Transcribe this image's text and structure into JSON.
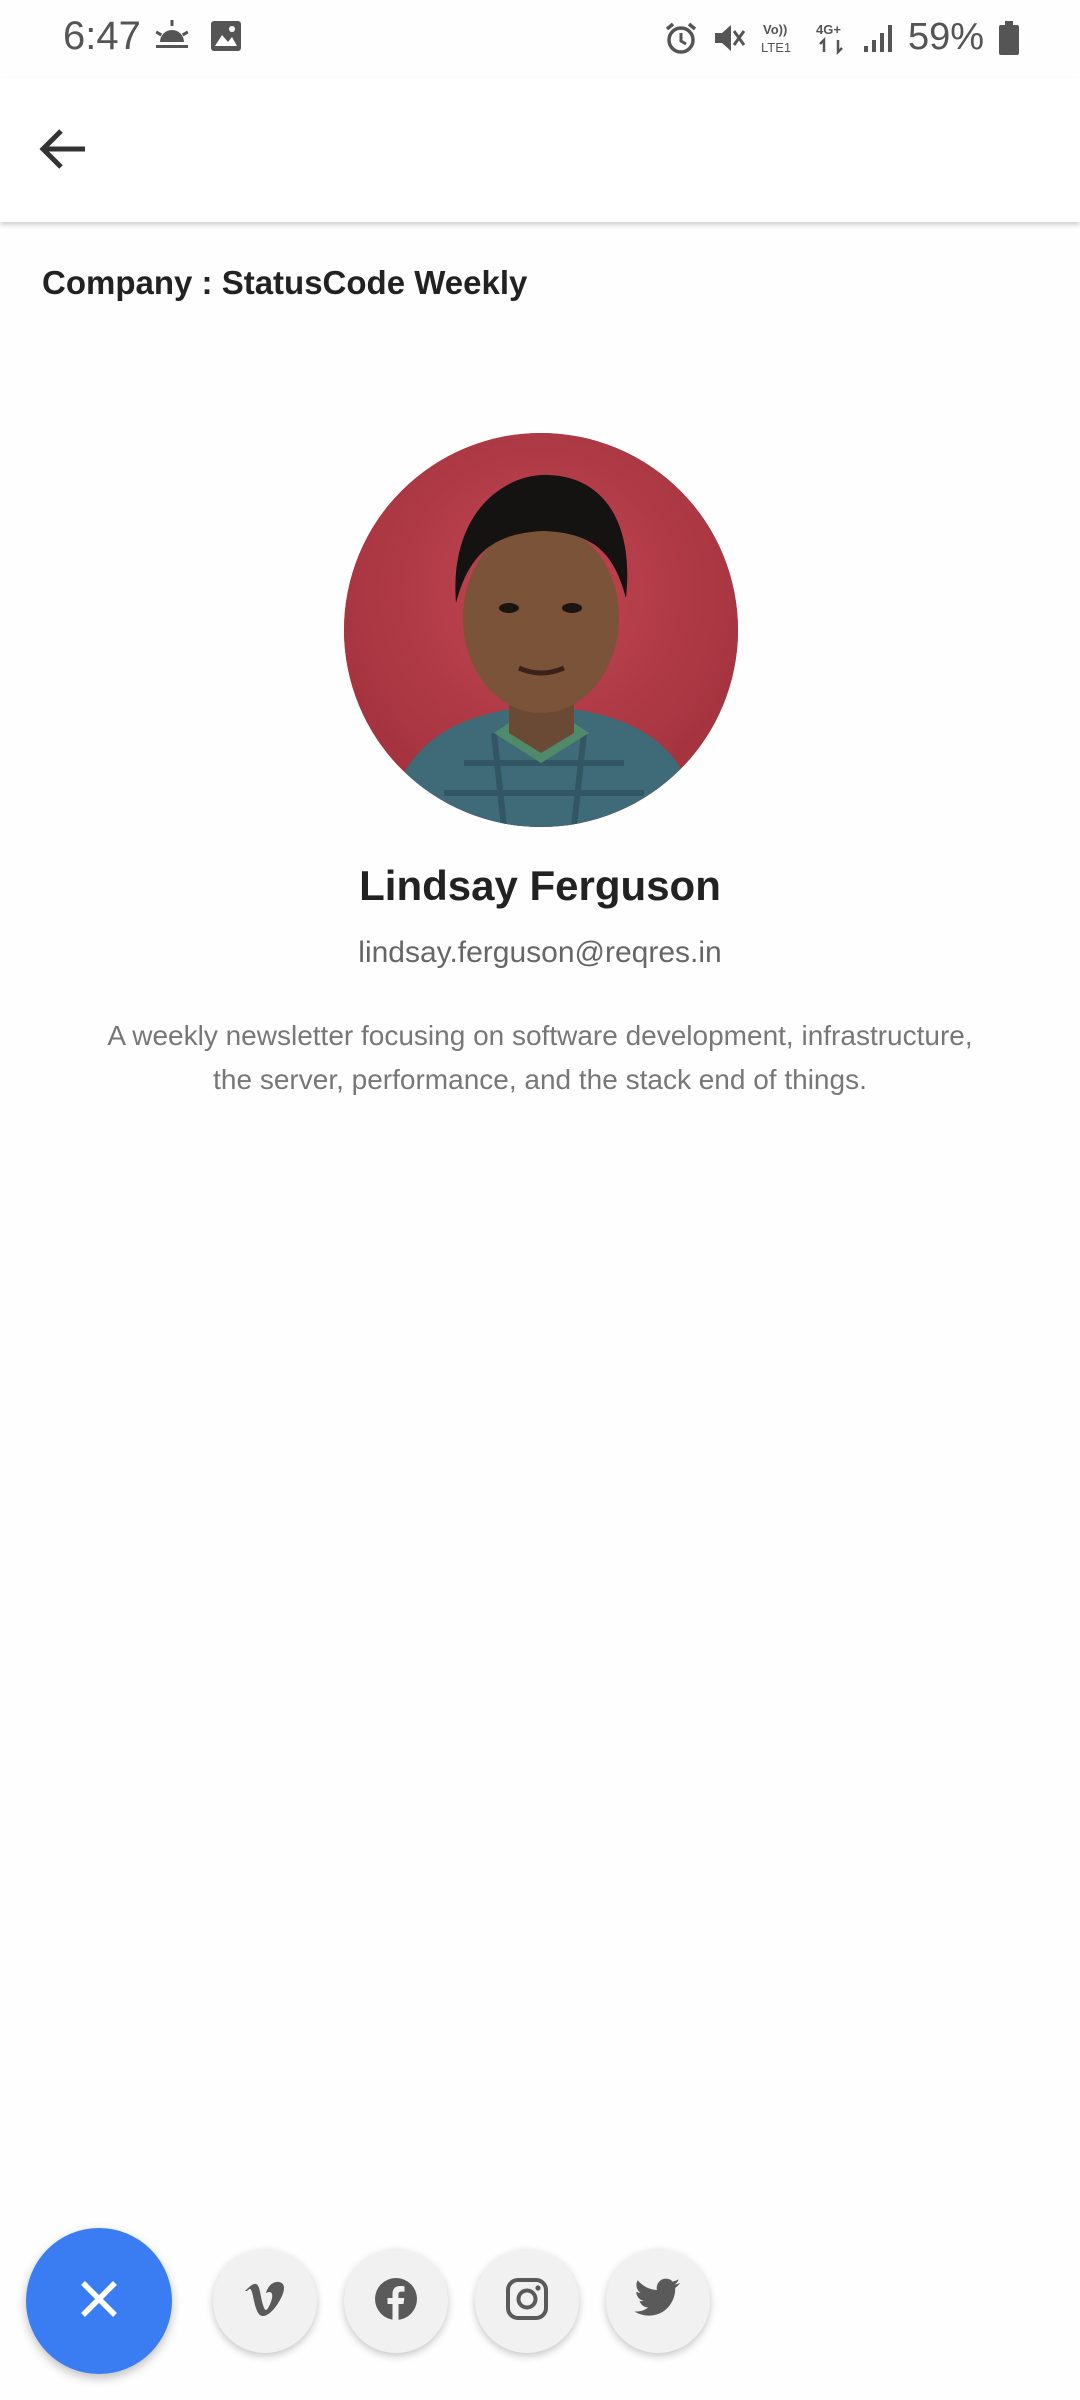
{
  "status_bar": {
    "time": "6:47",
    "battery": "59%",
    "icons": [
      "weather-sunrise-icon",
      "image-icon",
      "alarm-icon",
      "mute-icon",
      "volte-icon",
      "4g-icon",
      "signal-icon",
      "battery-icon"
    ]
  },
  "app_bar": {
    "back_icon": "arrow-back-icon"
  },
  "company": {
    "label": "Company",
    "separator": " : ",
    "name": "StatusCode Weekly"
  },
  "profile": {
    "name": "Lindsay Ferguson",
    "email": "lindsay.ferguson@reqres.in",
    "bio": "A weekly newsletter focusing on software development, infrastructure, the server, performance, and the stack end of things."
  },
  "actions": {
    "fab_icon": "close-icon",
    "fab_color": "#3a7cf2",
    "social": [
      "vimeo-icon",
      "facebook-icon",
      "instagram-icon",
      "twitter-icon"
    ]
  }
}
